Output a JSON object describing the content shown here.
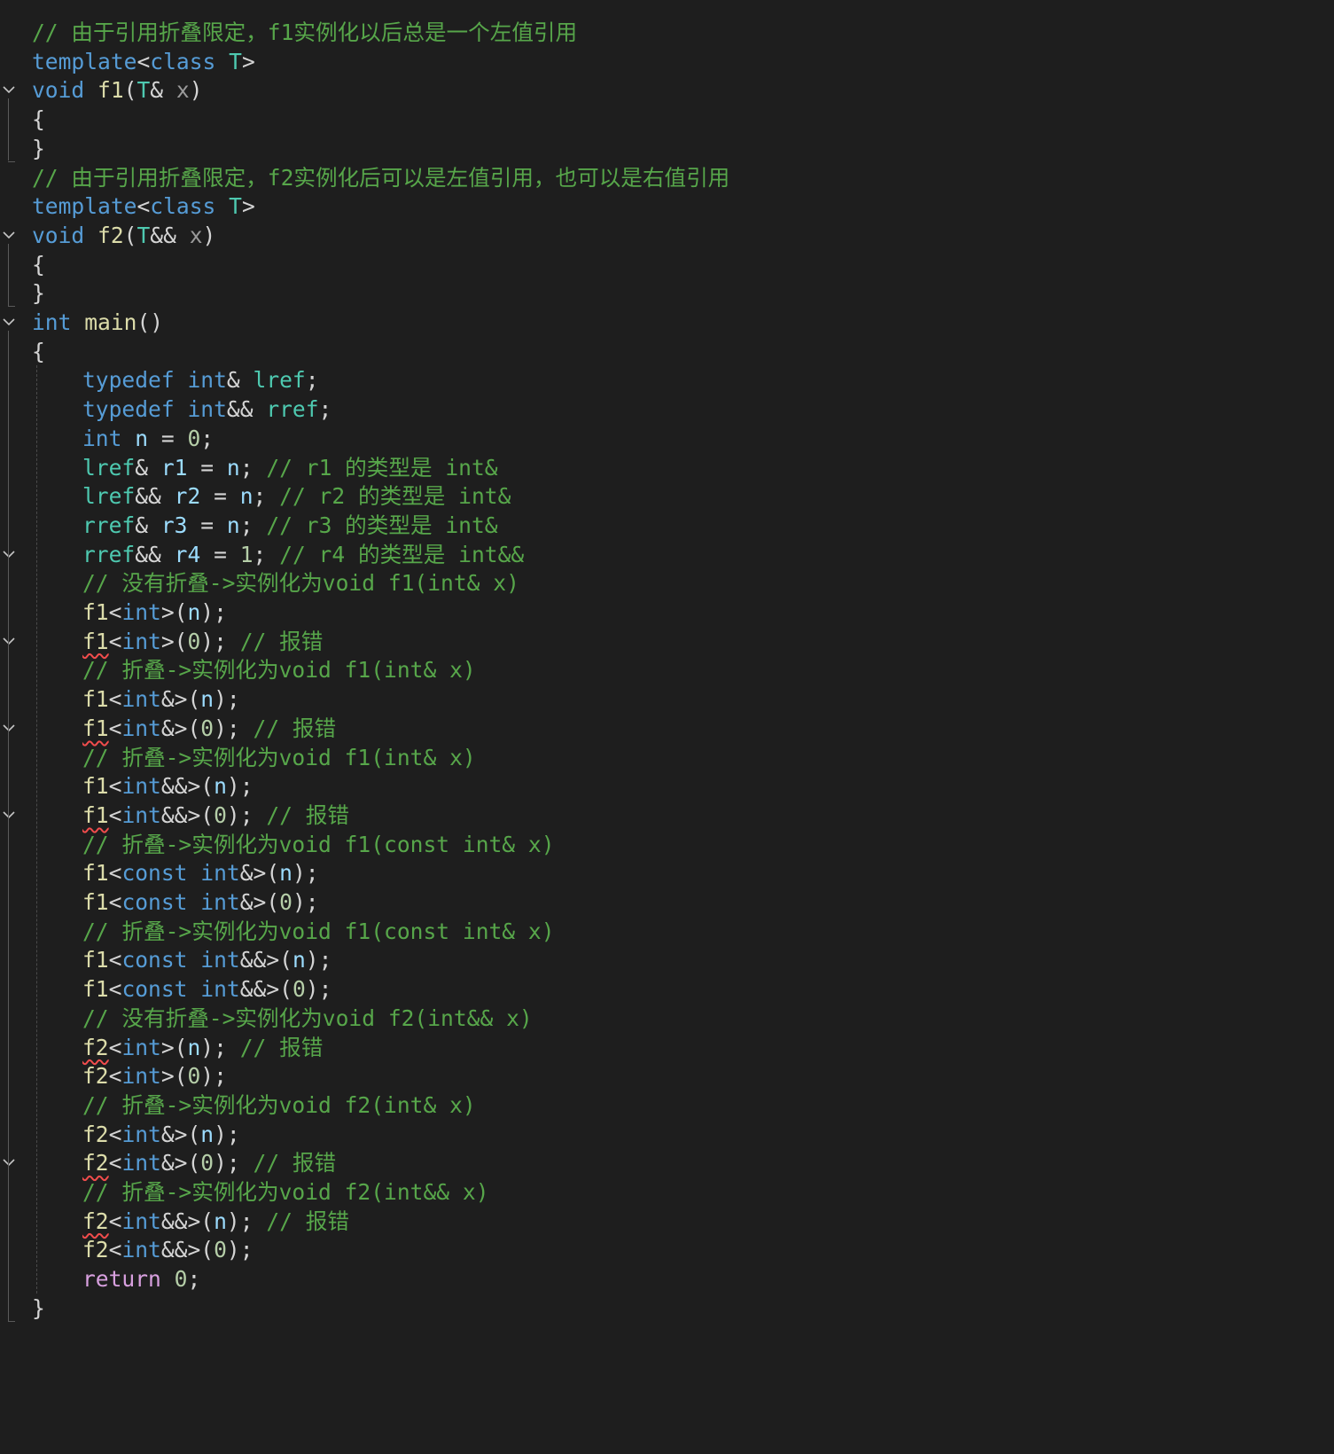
{
  "editor": {
    "language": "C++",
    "theme_colors": {
      "background": "#1e1e1e",
      "comment": "#57a64a",
      "keyword": "#569cd6",
      "type": "#4ec9b0",
      "function": "#dcdcaa",
      "variable": "#9cdcfe",
      "number": "#b5cea8",
      "control_keyword": "#d8a0df",
      "error_squiggle": "#f14c4c"
    },
    "lines": [
      {
        "indent": 0,
        "fold": false,
        "tokens": [
          [
            "cm",
            "// 由于引用折叠限定，f1实例化以后总是一个左值引用"
          ]
        ]
      },
      {
        "indent": 0,
        "fold": false,
        "tokens": [
          [
            "kw",
            "template"
          ],
          [
            "pu",
            "<"
          ],
          [
            "kw",
            "class"
          ],
          [
            "pu",
            " "
          ],
          [
            "ty",
            "T"
          ],
          [
            "pu",
            ">"
          ]
        ]
      },
      {
        "indent": 0,
        "fold": true,
        "tokens": [
          [
            "kw",
            "void"
          ],
          [
            "pu",
            " "
          ],
          [
            "fn",
            "f1"
          ],
          [
            "pu",
            "("
          ],
          [
            "ty",
            "T"
          ],
          [
            "pu",
            "& "
          ],
          [
            "pa",
            "x"
          ],
          [
            "pu",
            ")"
          ]
        ]
      },
      {
        "indent": 0,
        "fold": false,
        "tokens": [
          [
            "pu",
            "{"
          ]
        ]
      },
      {
        "indent": 0,
        "fold": false,
        "tokens": [
          [
            "pu",
            "}"
          ]
        ]
      },
      {
        "indent": 0,
        "fold": false,
        "tokens": [
          [
            "cm",
            "// 由于引用折叠限定，f2实例化后可以是左值引用，也可以是右值引用"
          ]
        ]
      },
      {
        "indent": 0,
        "fold": false,
        "tokens": [
          [
            "kw",
            "template"
          ],
          [
            "pu",
            "<"
          ],
          [
            "kw",
            "class"
          ],
          [
            "pu",
            " "
          ],
          [
            "ty",
            "T"
          ],
          [
            "pu",
            ">"
          ]
        ]
      },
      {
        "indent": 0,
        "fold": true,
        "tokens": [
          [
            "kw",
            "void"
          ],
          [
            "pu",
            " "
          ],
          [
            "fn",
            "f2"
          ],
          [
            "pu",
            "("
          ],
          [
            "ty",
            "T"
          ],
          [
            "pu",
            "&& "
          ],
          [
            "pa",
            "x"
          ],
          [
            "pu",
            ")"
          ]
        ]
      },
      {
        "indent": 0,
        "fold": false,
        "tokens": [
          [
            "pu",
            "{"
          ]
        ]
      },
      {
        "indent": 0,
        "fold": false,
        "tokens": [
          [
            "pu",
            "}"
          ]
        ]
      },
      {
        "indent": 0,
        "fold": true,
        "tokens": [
          [
            "kw",
            "int"
          ],
          [
            "pu",
            " "
          ],
          [
            "fn",
            "main"
          ],
          [
            "pu",
            "()"
          ]
        ]
      },
      {
        "indent": 0,
        "fold": false,
        "tokens": [
          [
            "pu",
            "{"
          ]
        ]
      },
      {
        "indent": 1,
        "fold": false,
        "tokens": [
          [
            "kw",
            "typedef"
          ],
          [
            "pu",
            " "
          ],
          [
            "kw",
            "int"
          ],
          [
            "pu",
            "& "
          ],
          [
            "ty",
            "lref"
          ],
          [
            "pu",
            ";"
          ]
        ]
      },
      {
        "indent": 1,
        "fold": false,
        "tokens": [
          [
            "kw",
            "typedef"
          ],
          [
            "pu",
            " "
          ],
          [
            "kw",
            "int"
          ],
          [
            "pu",
            "&& "
          ],
          [
            "ty",
            "rref"
          ],
          [
            "pu",
            ";"
          ]
        ]
      },
      {
        "indent": 1,
        "fold": false,
        "tokens": [
          [
            "kw",
            "int"
          ],
          [
            "pu",
            " "
          ],
          [
            "va",
            "n"
          ],
          [
            "pu",
            " = "
          ],
          [
            "nu",
            "0"
          ],
          [
            "pu",
            ";"
          ]
        ]
      },
      {
        "indent": 1,
        "fold": false,
        "tokens": [
          [
            "ty",
            "lref"
          ],
          [
            "pu",
            "& "
          ],
          [
            "va",
            "r1"
          ],
          [
            "pu",
            " = "
          ],
          [
            "va",
            "n"
          ],
          [
            "pu",
            "; "
          ],
          [
            "cm",
            "// r1 的类型是 int&"
          ]
        ]
      },
      {
        "indent": 1,
        "fold": false,
        "tokens": [
          [
            "ty",
            "lref"
          ],
          [
            "pu",
            "&& "
          ],
          [
            "va",
            "r2"
          ],
          [
            "pu",
            " = "
          ],
          [
            "va",
            "n"
          ],
          [
            "pu",
            "; "
          ],
          [
            "cm",
            "// r2 的类型是 int&"
          ]
        ]
      },
      {
        "indent": 1,
        "fold": false,
        "tokens": [
          [
            "ty",
            "rref"
          ],
          [
            "pu",
            "& "
          ],
          [
            "va",
            "r3"
          ],
          [
            "pu",
            " = "
          ],
          [
            "va",
            "n"
          ],
          [
            "pu",
            "; "
          ],
          [
            "cm",
            "// r3 的类型是 int&"
          ]
        ]
      },
      {
        "indent": 1,
        "fold": true,
        "tokens": [
          [
            "ty",
            "rref"
          ],
          [
            "pu",
            "&& "
          ],
          [
            "va",
            "r4"
          ],
          [
            "pu",
            " = "
          ],
          [
            "nu",
            "1"
          ],
          [
            "pu",
            "; "
          ],
          [
            "cm",
            "// r4 的类型是 int&&"
          ]
        ]
      },
      {
        "indent": 1,
        "fold": false,
        "tokens": [
          [
            "cm",
            "// 没有折叠->实例化为void f1(int& x)"
          ]
        ]
      },
      {
        "indent": 1,
        "fold": false,
        "tokens": [
          [
            "fn",
            "f1"
          ],
          [
            "pu",
            "<"
          ],
          [
            "kw",
            "int"
          ],
          [
            "pu",
            ">("
          ],
          [
            "va",
            "n"
          ],
          [
            "pu",
            ");"
          ]
        ]
      },
      {
        "indent": 1,
        "fold": true,
        "tokens": [
          [
            "fn!",
            "f1"
          ],
          [
            "pu",
            "<"
          ],
          [
            "kw",
            "int"
          ],
          [
            "pu",
            ">("
          ],
          [
            "nu",
            "0"
          ],
          [
            "pu",
            "); "
          ],
          [
            "cm",
            "// 报错"
          ]
        ]
      },
      {
        "indent": 1,
        "fold": false,
        "tokens": [
          [
            "cm",
            "// 折叠->实例化为void f1(int& x)"
          ]
        ]
      },
      {
        "indent": 1,
        "fold": false,
        "tokens": [
          [
            "fn",
            "f1"
          ],
          [
            "pu",
            "<"
          ],
          [
            "kw",
            "int"
          ],
          [
            "pu",
            "&>("
          ],
          [
            "va",
            "n"
          ],
          [
            "pu",
            ");"
          ]
        ]
      },
      {
        "indent": 1,
        "fold": true,
        "tokens": [
          [
            "fn!",
            "f1"
          ],
          [
            "pu",
            "<"
          ],
          [
            "kw",
            "int"
          ],
          [
            "pu",
            "&>("
          ],
          [
            "nu",
            "0"
          ],
          [
            "pu",
            "); "
          ],
          [
            "cm",
            "// 报错"
          ]
        ]
      },
      {
        "indent": 1,
        "fold": false,
        "tokens": [
          [
            "cm",
            "// 折叠->实例化为void f1(int& x)"
          ]
        ]
      },
      {
        "indent": 1,
        "fold": false,
        "tokens": [
          [
            "fn",
            "f1"
          ],
          [
            "pu",
            "<"
          ],
          [
            "kw",
            "int"
          ],
          [
            "pu",
            "&&>("
          ],
          [
            "va",
            "n"
          ],
          [
            "pu",
            ");"
          ]
        ]
      },
      {
        "indent": 1,
        "fold": true,
        "tokens": [
          [
            "fn!",
            "f1"
          ],
          [
            "pu",
            "<"
          ],
          [
            "kw",
            "int"
          ],
          [
            "pu",
            "&&>("
          ],
          [
            "nu",
            "0"
          ],
          [
            "pu",
            "); "
          ],
          [
            "cm",
            "// 报错"
          ]
        ]
      },
      {
        "indent": 1,
        "fold": false,
        "tokens": [
          [
            "cm",
            "// 折叠->实例化为void f1(const int& x)"
          ]
        ]
      },
      {
        "indent": 1,
        "fold": false,
        "tokens": [
          [
            "fn",
            "f1"
          ],
          [
            "pu",
            "<"
          ],
          [
            "kw",
            "const"
          ],
          [
            "pu",
            " "
          ],
          [
            "kw",
            "int"
          ],
          [
            "pu",
            "&>("
          ],
          [
            "va",
            "n"
          ],
          [
            "pu",
            ");"
          ]
        ]
      },
      {
        "indent": 1,
        "fold": false,
        "tokens": [
          [
            "fn",
            "f1"
          ],
          [
            "pu",
            "<"
          ],
          [
            "kw",
            "const"
          ],
          [
            "pu",
            " "
          ],
          [
            "kw",
            "int"
          ],
          [
            "pu",
            "&>("
          ],
          [
            "nu",
            "0"
          ],
          [
            "pu",
            ");"
          ]
        ]
      },
      {
        "indent": 1,
        "fold": false,
        "tokens": [
          [
            "cm",
            "// 折叠->实例化为void f1(const int& x)"
          ]
        ]
      },
      {
        "indent": 1,
        "fold": false,
        "tokens": [
          [
            "fn",
            "f1"
          ],
          [
            "pu",
            "<"
          ],
          [
            "kw",
            "const"
          ],
          [
            "pu",
            " "
          ],
          [
            "kw",
            "int"
          ],
          [
            "pu",
            "&&>("
          ],
          [
            "va",
            "n"
          ],
          [
            "pu",
            ");"
          ]
        ]
      },
      {
        "indent": 1,
        "fold": false,
        "tokens": [
          [
            "fn",
            "f1"
          ],
          [
            "pu",
            "<"
          ],
          [
            "kw",
            "const"
          ],
          [
            "pu",
            " "
          ],
          [
            "kw",
            "int"
          ],
          [
            "pu",
            "&&>("
          ],
          [
            "nu",
            "0"
          ],
          [
            "pu",
            ");"
          ]
        ]
      },
      {
        "indent": 1,
        "fold": false,
        "tokens": [
          [
            "cm",
            "// 没有折叠->实例化为void f2(int&& x)"
          ]
        ]
      },
      {
        "indent": 1,
        "fold": false,
        "tokens": [
          [
            "fn!",
            "f2"
          ],
          [
            "pu",
            "<"
          ],
          [
            "kw",
            "int"
          ],
          [
            "pu",
            ">("
          ],
          [
            "va",
            "n"
          ],
          [
            "pu",
            "); "
          ],
          [
            "cm",
            "// 报错"
          ]
        ]
      },
      {
        "indent": 1,
        "fold": false,
        "tokens": [
          [
            "fn",
            "f2"
          ],
          [
            "pu",
            "<"
          ],
          [
            "kw",
            "int"
          ],
          [
            "pu",
            ">("
          ],
          [
            "nu",
            "0"
          ],
          [
            "pu",
            ");"
          ]
        ]
      },
      {
        "indent": 1,
        "fold": false,
        "tokens": [
          [
            "cm",
            "// 折叠->实例化为void f2(int& x)"
          ]
        ]
      },
      {
        "indent": 1,
        "fold": false,
        "tokens": [
          [
            "fn",
            "f2"
          ],
          [
            "pu",
            "<"
          ],
          [
            "kw",
            "int"
          ],
          [
            "pu",
            "&>("
          ],
          [
            "va",
            "n"
          ],
          [
            "pu",
            ");"
          ]
        ]
      },
      {
        "indent": 1,
        "fold": true,
        "tokens": [
          [
            "fn!",
            "f2"
          ],
          [
            "pu",
            "<"
          ],
          [
            "kw",
            "int"
          ],
          [
            "pu",
            "&>("
          ],
          [
            "nu",
            "0"
          ],
          [
            "pu",
            "); "
          ],
          [
            "cm",
            "// 报错"
          ]
        ]
      },
      {
        "indent": 1,
        "fold": false,
        "tokens": [
          [
            "cm",
            "// 折叠->实例化为void f2(int&& x)"
          ]
        ]
      },
      {
        "indent": 1,
        "fold": false,
        "tokens": [
          [
            "fn!",
            "f2"
          ],
          [
            "pu",
            "<"
          ],
          [
            "kw",
            "int"
          ],
          [
            "pu",
            "&&>("
          ],
          [
            "va",
            "n"
          ],
          [
            "pu",
            "); "
          ],
          [
            "cm",
            "// 报错"
          ]
        ]
      },
      {
        "indent": 1,
        "fold": false,
        "tokens": [
          [
            "fn",
            "f2"
          ],
          [
            "pu",
            "<"
          ],
          [
            "kw",
            "int"
          ],
          [
            "pu",
            "&&>("
          ],
          [
            "nu",
            "0"
          ],
          [
            "pu",
            ");"
          ]
        ]
      },
      {
        "indent": 1,
        "fold": false,
        "tokens": [
          [
            "pl",
            "return"
          ],
          [
            "pu",
            " "
          ],
          [
            "nu",
            "0"
          ],
          [
            "pu",
            ";"
          ]
        ]
      },
      {
        "indent": 0,
        "fold": false,
        "tokens": [
          [
            "pu",
            "}"
          ]
        ]
      }
    ]
  }
}
